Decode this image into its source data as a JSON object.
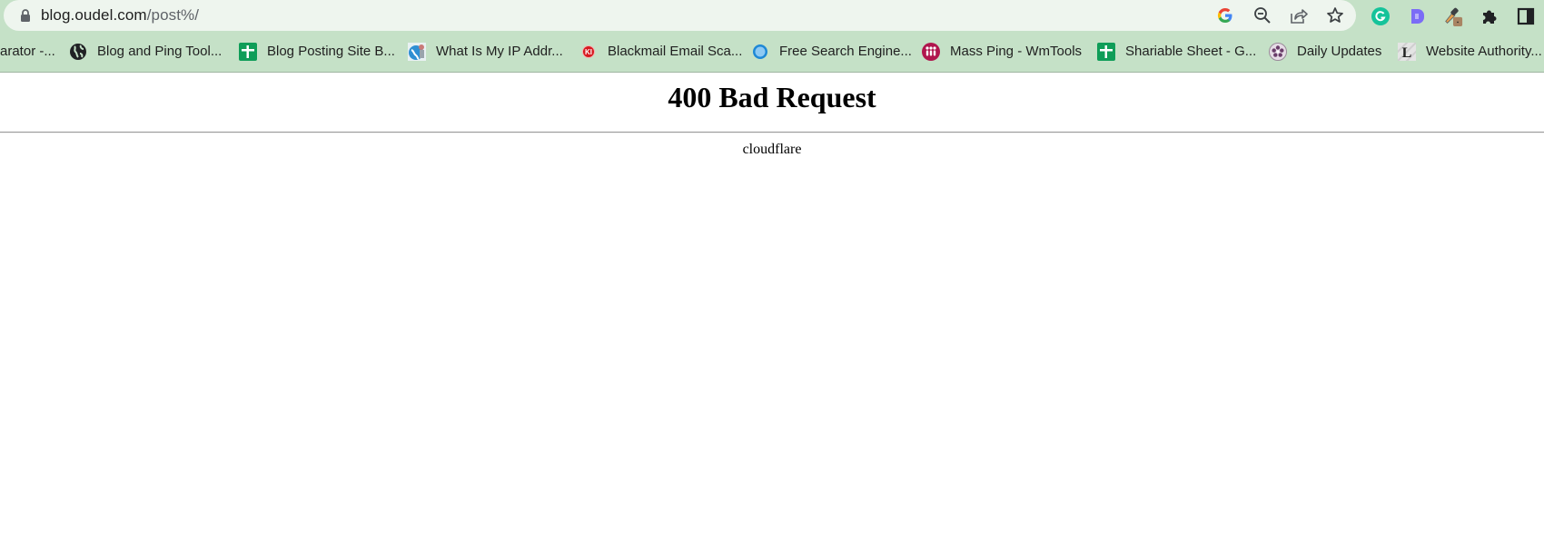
{
  "browser": {
    "url_host": "blog.oudel.com",
    "url_path": "/post%/",
    "omnibox_icons": [
      {
        "name": "google-lens-icon",
        "label": "Search with Google"
      },
      {
        "name": "zoom-out-icon",
        "label": "Zoom"
      },
      {
        "name": "share-icon",
        "label": "Share"
      },
      {
        "name": "bookmark-star-icon",
        "label": "Bookmark this tab"
      }
    ],
    "extensions": [
      {
        "name": "grammarly-icon"
      },
      {
        "name": "dashlane-d-icon"
      },
      {
        "name": "eyedropper-icon"
      },
      {
        "name": "extensions-puzzle-icon"
      },
      {
        "name": "side-panel-icon"
      }
    ]
  },
  "bookmarks": [
    {
      "label": "arator -...",
      "icon": "none"
    },
    {
      "label": "Blog and Ping Tool...",
      "icon": "globe-icon"
    },
    {
      "label": "Blog Posting Site B...",
      "icon": "google-sheets-icon"
    },
    {
      "label": "What Is My IP Addr...",
      "icon": "ip-globe-icon"
    },
    {
      "label": "Blackmail Email Sca...",
      "icon": "red-k-icon"
    },
    {
      "label": "Free Search Engine...",
      "icon": "blue-circle-icon"
    },
    {
      "label": "Mass Ping - WmTools",
      "icon": "wmtools-icon"
    },
    {
      "label": "Shariable Sheet - G...",
      "icon": "google-sheets-icon"
    },
    {
      "label": "Daily Updates",
      "icon": "flower-icon"
    },
    {
      "label": "Website Authority...",
      "icon": "letter-l-icon"
    }
  ],
  "page": {
    "title": "400 Bad Request",
    "server": "cloudflare"
  },
  "colors": {
    "chrome_bg": "#c5e1c7",
    "omnibox_bg": "#eef5ee",
    "sheets_green": "#0f9d58",
    "grammarly_teal": "#15c39a",
    "dashlane_purple": "#7b6cf6"
  }
}
